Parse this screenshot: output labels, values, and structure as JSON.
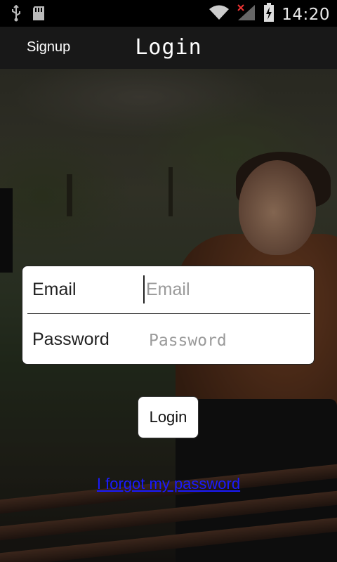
{
  "status_bar": {
    "time": "14:20",
    "icons": [
      "usb-icon",
      "sd-card-icon",
      "wifi-icon",
      "no-signal-icon",
      "battery-charging-icon"
    ]
  },
  "action_bar": {
    "signup_label": "Signup",
    "title": "Login"
  },
  "form": {
    "email_label": "Email",
    "email_placeholder": "Email",
    "email_value": "",
    "password_label": "Password",
    "password_placeholder": "Password",
    "password_value": ""
  },
  "login_button_label": "Login",
  "forgot_password_label": "I forgot my password",
  "colors": {
    "link": "#1a1aff",
    "action_bar": "#181818",
    "status_bar": "#000000"
  }
}
